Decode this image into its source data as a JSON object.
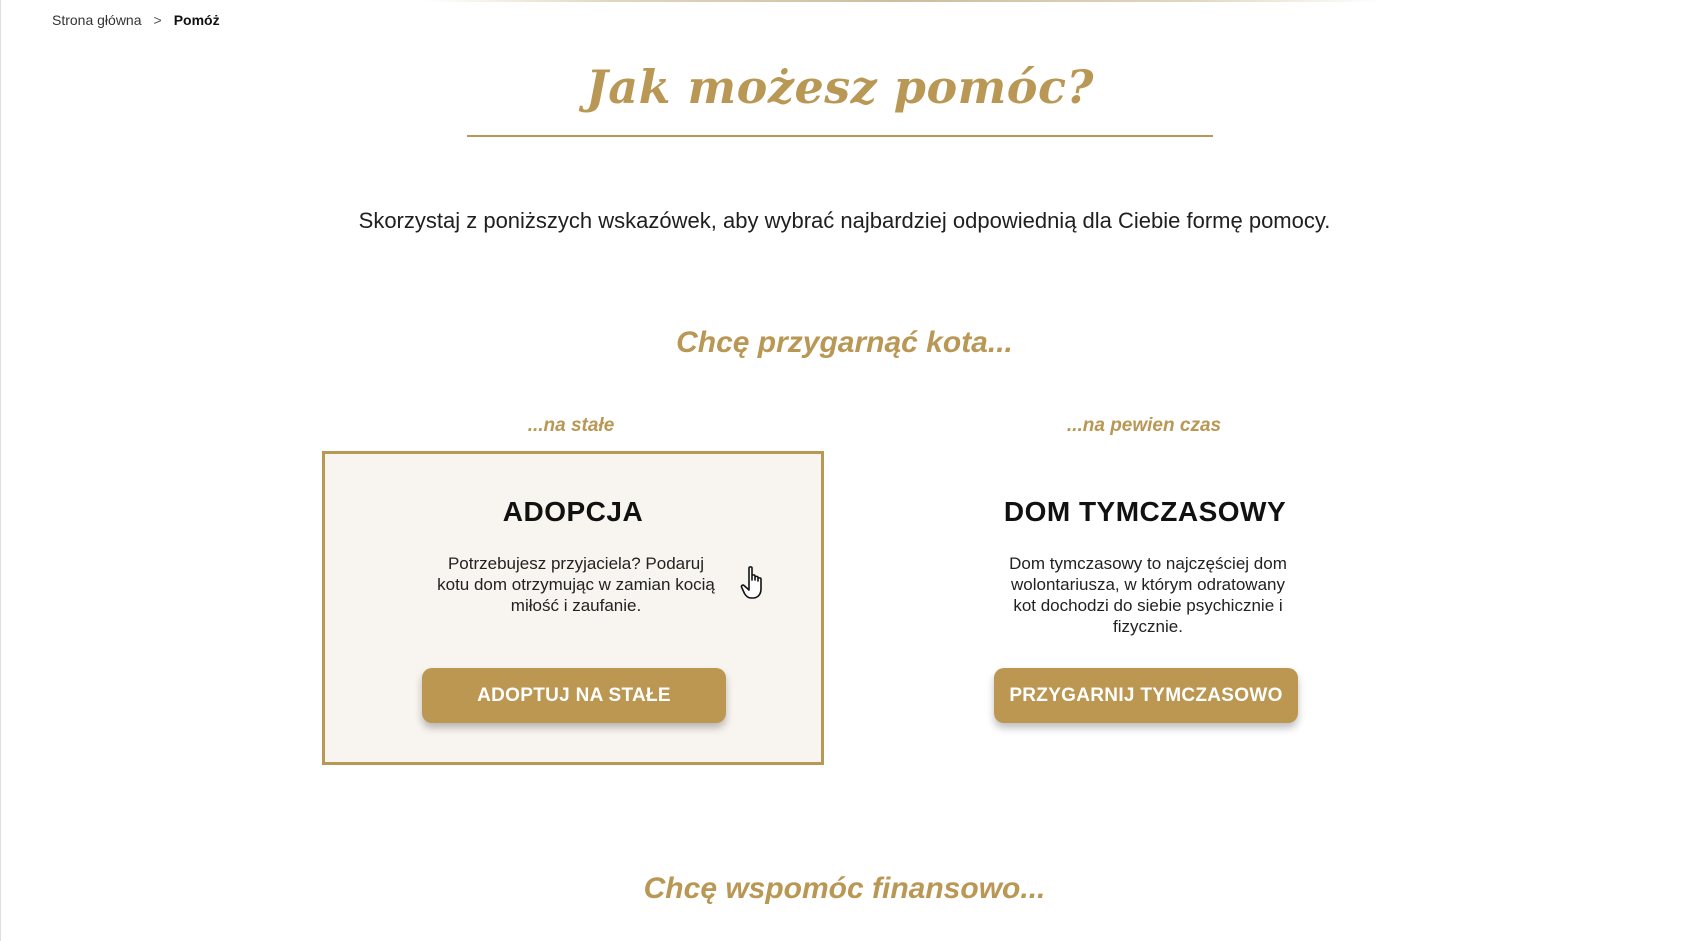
{
  "breadcrumb": {
    "home": "Strona główna",
    "separator": ">",
    "current": "Pomóż"
  },
  "header": {
    "title": "Jak możesz pomóc?",
    "intro": "Skorzystaj z poniższych wskazówek, aby wybrać najbardziej odpowiednią dla Ciebie formę  pomocy."
  },
  "sections": {
    "adopt_heading": "Chcę przygarnąć kota...",
    "finance_heading": "Chcę wspomóc finansowo..."
  },
  "cards": {
    "permanent": {
      "subheading": "...na stałe",
      "title": "ADOPCJA",
      "description": "Potrzebujesz przyjaciela? Podaruj kotu dom otrzymując w zamian kocią miłość i zaufanie.",
      "button": "ADOPTUJ NA STAŁE"
    },
    "temporary": {
      "subheading": "...na pewien czas",
      "title": "DOM TYMCZASOWY",
      "description": "Dom tymczasowy to najczęściej dom wolontariusza, w którym odratowany kot dochodzi do siebie psychicznie i fizycznie.",
      "button": "PRZYGARNIJ TYMCZASOWO"
    }
  },
  "icons": {
    "cursor": "hand-pointer-icon"
  },
  "colors": {
    "accent": "#b99754",
    "card_background": "#f8f4ef",
    "button": "#bb9751"
  }
}
